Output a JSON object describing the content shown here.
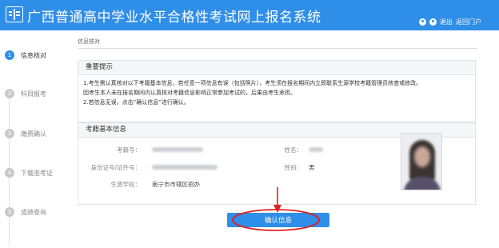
{
  "header": {
    "title": "广西普通高中学业水平合格性考试网上报名系统",
    "logout_label": "退出",
    "portal_label": "返回门户"
  },
  "steps": [
    {
      "num": "1",
      "label": "信息核对",
      "active": true
    },
    {
      "num": "2",
      "label": "科目报考",
      "active": false
    },
    {
      "num": "3",
      "label": "缴费确认",
      "active": false
    },
    {
      "num": "4",
      "label": "下载准考证",
      "active": false
    },
    {
      "num": "5",
      "label": "成绩查询",
      "active": false
    }
  ],
  "breadcrumb": "信息核对",
  "notice": {
    "title": "重要提示",
    "lines": [
      "1.考生需认真核对以下考籍基本信息，若任意一项信息有误（包括照片），考生须在报名期间内立即联系生源学校考籍管理员核查或修改。",
      "因考生本人未在报名期间内认真核对考籍信息影响正常参加考试的，后果由考生承担。",
      "2.若信息无误，点击“确认信息”进行确认。"
    ]
  },
  "info": {
    "title": "考籍基本信息",
    "exam_no_label": "考籍号：",
    "id_label": "身份证号/证件号：",
    "school_label": "生源学校：",
    "school_value": "南宁市市辖区招办",
    "name_label": "姓名：",
    "gender_label": "性别：",
    "gender_value": "男"
  },
  "confirm_label": "确认信息",
  "colors": {
    "brand": "#2f8ee8",
    "annotation": "#e02020"
  }
}
